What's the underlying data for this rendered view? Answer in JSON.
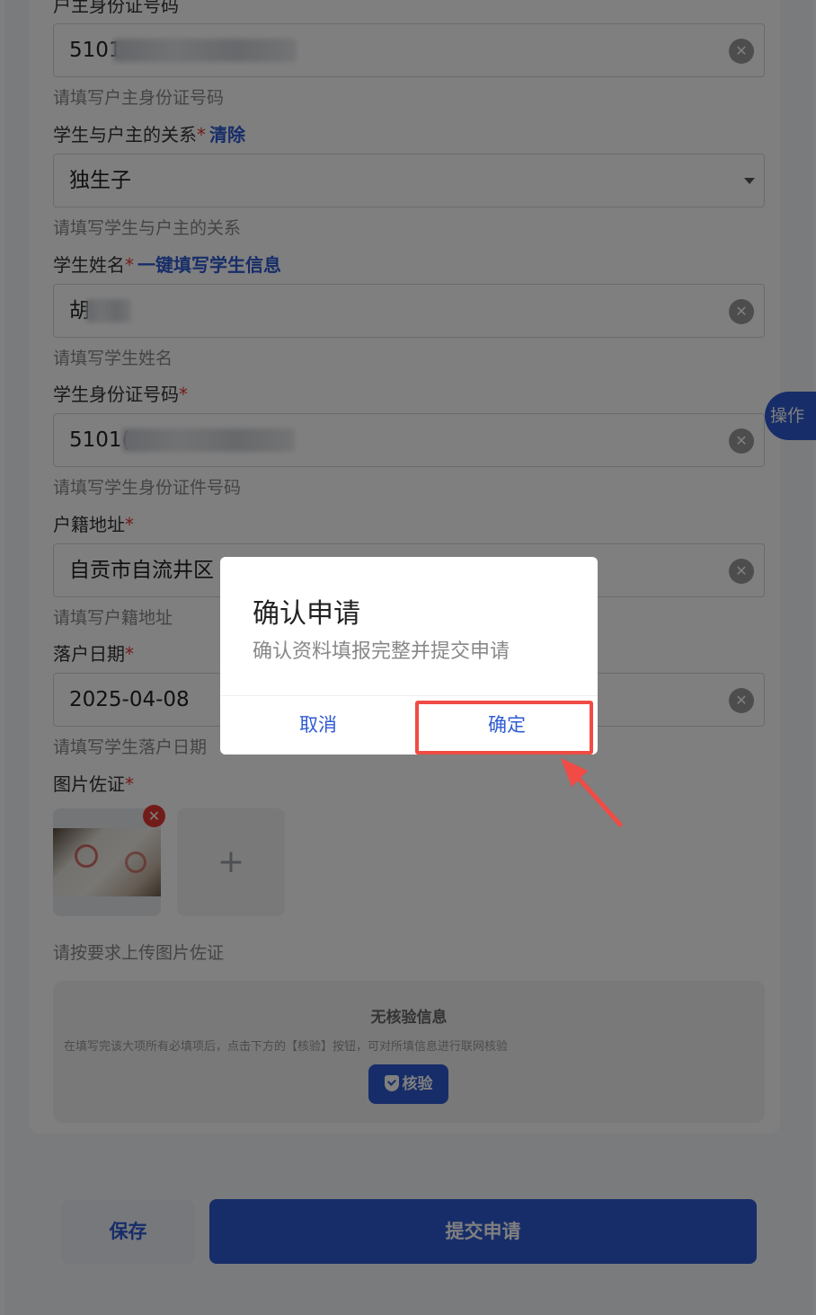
{
  "form": {
    "householder_id": {
      "label_partial": "户主身份证号码",
      "value_visible": "5101",
      "hint": "请填写户主身份证号码"
    },
    "relation": {
      "label": "学生与户主的关系",
      "required_mark": "*",
      "link": "清除",
      "value": "独生子",
      "hint": "请填写学生与户主的关系"
    },
    "student_name": {
      "label": "学生姓名",
      "required_mark": "*",
      "link": "一键填写学生信息",
      "value_visible": "胡",
      "hint": "请填写学生姓名"
    },
    "student_id": {
      "label": "学生身份证号码",
      "required_mark": "*",
      "value_visible": "5101(",
      "hint": "请填写学生身份证件号码"
    },
    "address": {
      "label": "户籍地址",
      "required_mark": "*",
      "value": "自贡市自流井区",
      "hint": "请填写户籍地址"
    },
    "settle_date": {
      "label": "落户日期",
      "required_mark": "*",
      "value": "2025-04-08",
      "hint": "请填写学生落户日期"
    },
    "photos": {
      "label": "图片佐证",
      "required_mark": "*",
      "plus": "+",
      "hint": "请按要求上传图片佐证"
    }
  },
  "side_tab": "操作",
  "verify": {
    "title": "无核验信息",
    "desc": "在填写完该大项所有必填项后，点击下方的【核验】按钮，可对所填信息进行联网核验",
    "button": "核验"
  },
  "bottom": {
    "save": "保存",
    "submit": "提交申请"
  },
  "dialog": {
    "title": "确认申请",
    "message": "确认资料填报完整并提交申请",
    "cancel": "取消",
    "ok": "确定"
  },
  "colors": {
    "accent": "#2f5bd3",
    "required": "#e53935",
    "highlight": "#f04b45",
    "mask": "rgba(0,0,0,0.5)"
  }
}
